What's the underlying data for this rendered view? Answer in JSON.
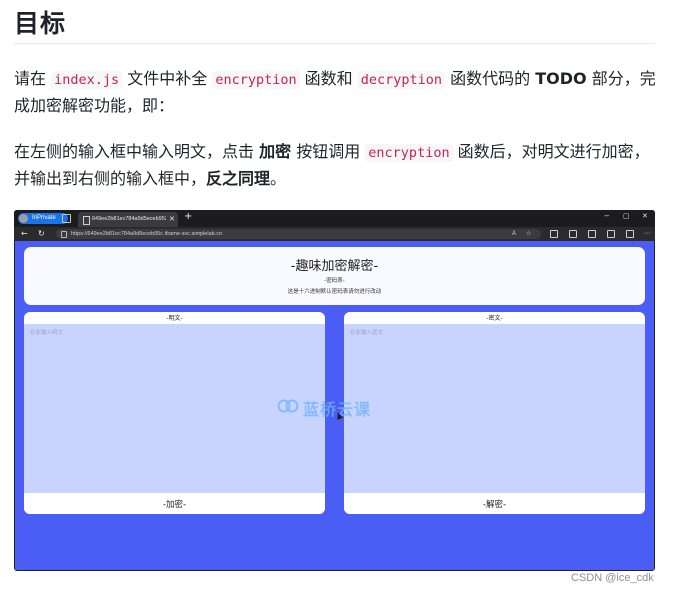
{
  "heading": "目标",
  "para1": {
    "t1": "请在 ",
    "code1": "index.js",
    "t2": " 文件中补全 ",
    "code2": "encryption",
    "t3": " 函数和 ",
    "code3": "decryption",
    "t4": " 函数代码的 ",
    "bold1": "TODO",
    "t5": " 部分，完成加密解密功能，即："
  },
  "para2": {
    "t1": "在左侧的输入框中输入明文，点击 ",
    "bold1": "加密",
    "t2": " 按钮调用 ",
    "code1": "encryption",
    "t3": " 函数后，对明文进行加密，并输出到右侧的输入框中，",
    "bold2": "反之同理",
    "t4": "。"
  },
  "browser": {
    "profile_label": "InPrivate",
    "tab_title": "649ee2b81ec784a9d5eceb952c",
    "new_tab": "+",
    "url": "https://649ee2b81ec784a9d5eceb95c.iframe-svc.simplelab.cn",
    "controls": {
      "minimize": "−",
      "maximize": "▢",
      "close": "✕"
    }
  },
  "app": {
    "title": "-趣味加密解密-",
    "subtitle": "-密码表-",
    "description": "这是十六进制默认密码表请勿进行改动",
    "left_panel": {
      "header": "-明文-",
      "placeholder": "在此输入明文",
      "button": "-加密-"
    },
    "right_panel": {
      "header": "-密文-",
      "placeholder": "在此输入密文",
      "button": "-解密-"
    },
    "watermark": "蓝桥云课"
  },
  "credit": "CSDN @ice_cdk",
  "colors": {
    "viewport_bg": "#4a5df5",
    "panel_fill": "#c8d4fd",
    "code_text": "#c7254e",
    "watermark": "#6fb2ff"
  }
}
